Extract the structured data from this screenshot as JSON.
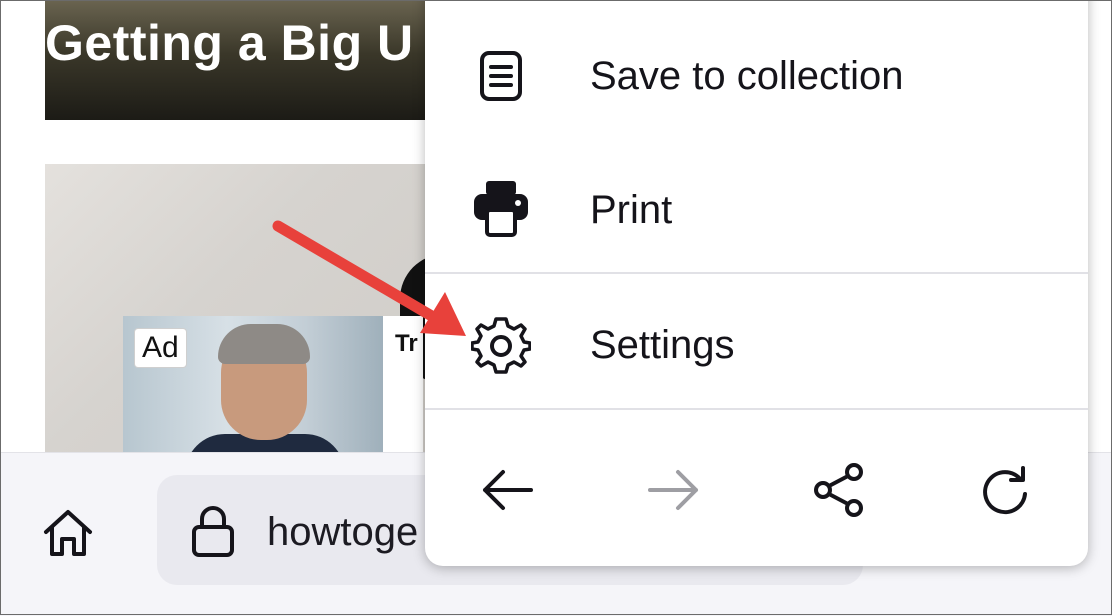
{
  "page": {
    "hero_title": "Getting a Big U",
    "ad_label": "Ad",
    "ad_title": "Tr"
  },
  "toolbar": {
    "home_icon": "home-icon",
    "lock_icon": "lock-icon",
    "url_text": "howtoge"
  },
  "menu": {
    "items": [
      {
        "label": "Save to collection",
        "icon": "collection-icon"
      },
      {
        "label": "Print",
        "icon": "print-icon"
      },
      {
        "label": "Settings",
        "icon": "gear-icon"
      }
    ],
    "nav": [
      {
        "icon": "back-arrow-icon",
        "enabled": true
      },
      {
        "icon": "forward-arrow-icon",
        "enabled": false
      },
      {
        "icon": "share-icon",
        "enabled": true
      },
      {
        "icon": "reload-icon",
        "enabled": true
      }
    ]
  },
  "annotation": {
    "color": "#e8413b",
    "points_to": "Settings"
  },
  "colors": {
    "text": "#15141a",
    "disabled": "#9e9ea3",
    "toolbar_bg": "#f5f5f9",
    "urlbar_bg": "#e9e9ef"
  }
}
